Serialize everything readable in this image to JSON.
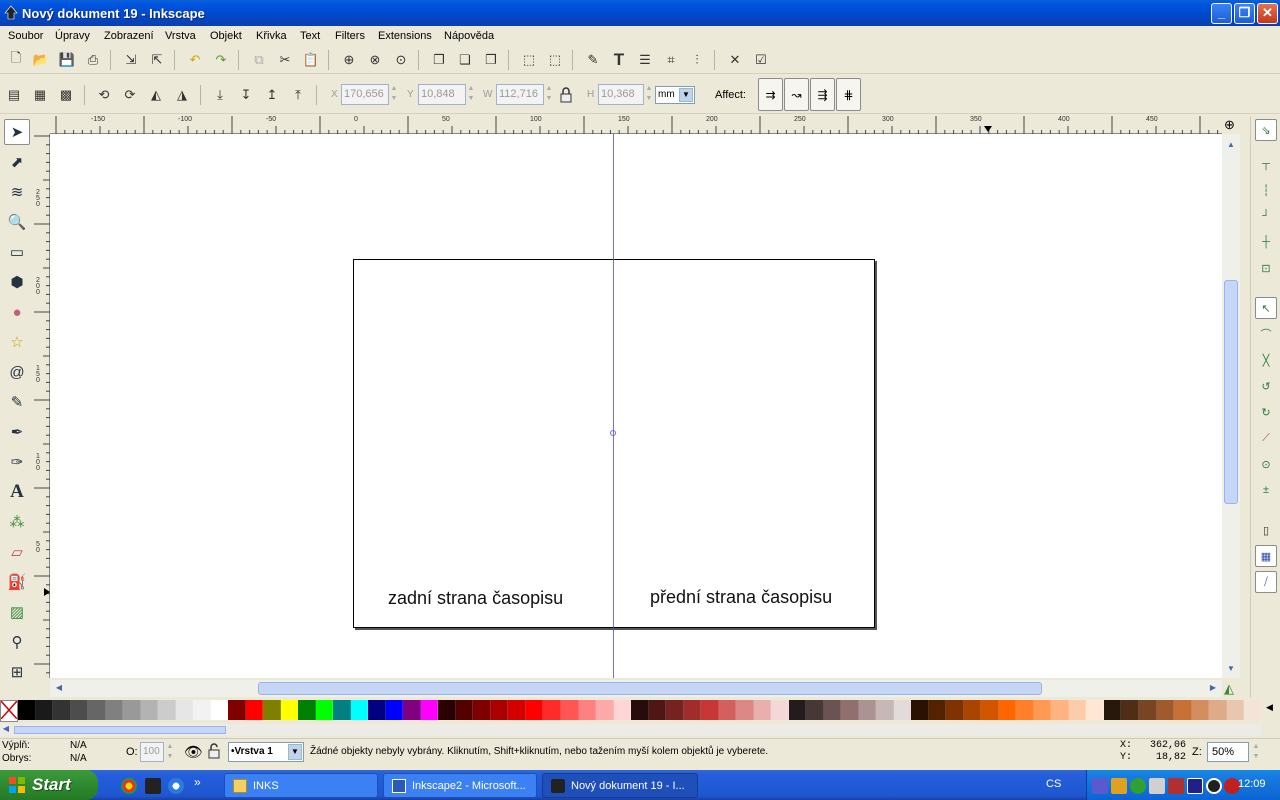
{
  "window": {
    "title": "Nový dokument 19 - Inkscape",
    "minimize": "_",
    "maximize": "❐",
    "close": "✕"
  },
  "menu": [
    "Soubor",
    "Úpravy",
    "Zobrazení",
    "Vrstva",
    "Objekt",
    "Křivka",
    "Text",
    "Filters",
    "Extensions",
    "Nápověda"
  ],
  "selectbar": {
    "x_label": "X",
    "x_value": "170,656",
    "y_label": "Y",
    "y_value": "10,848",
    "w_label": "W",
    "w_value": "112,716",
    "h_label": "H",
    "h_value": "10,368",
    "unit": "mm",
    "affect_label": "Affect:"
  },
  "ruler": {
    "h_labels": [
      "-150",
      "-100",
      "-50",
      "0",
      "50",
      "100",
      "150",
      "200",
      "250",
      "300",
      "350",
      "400",
      "450"
    ],
    "v_labels": [
      "250",
      "200",
      "150",
      "100",
      "50"
    ]
  },
  "canvas": {
    "left_text": "zadní strana časopisu",
    "right_text": "přední strana časopisu"
  },
  "status": {
    "fill_label": "Výplň:",
    "fill_value": "N/A",
    "stroke_label": "Obrys:",
    "stroke_value": "N/A",
    "opacity_label": "O:",
    "opacity_value": "100",
    "layer": "•Vrstva 1",
    "message": "Žádné objekty nebyly vybrány. Kliknutím, Shift+kliknutím, nebo tažením myší kolem objektů je vyberete.",
    "x_coord": "X:   362,06",
    "y_coord": "Y:    18,82",
    "zoom_label": "Z:",
    "zoom_value": "50%"
  },
  "taskbar": {
    "start": "Start",
    "tasks": [
      "INKS",
      "Inkscape2 - Microsoft...",
      "Nový dokument 19 - I..."
    ],
    "language": "CS",
    "clock": "12:09",
    "chevron": "»"
  },
  "palette_colors": [
    "#000000",
    "#1a1a1a",
    "#333333",
    "#4d4d4d",
    "#666666",
    "#808080",
    "#999999",
    "#b3b3b3",
    "#cccccc",
    "#e6e6e6",
    "#f2f2f2",
    "#ffffff",
    "#800000",
    "#ff0000",
    "#808000",
    "#ffff00",
    "#008000",
    "#00ff00",
    "#008080",
    "#00ffff",
    "#000080",
    "#0000ff",
    "#800080",
    "#ff00ff",
    "#2b0000",
    "#550000",
    "#800000",
    "#aa0000",
    "#d40000",
    "#ff0000",
    "#ff2a2a",
    "#ff5555",
    "#ff8080",
    "#ffaaaa",
    "#ffd5d5",
    "#280b0b",
    "#501616",
    "#782121",
    "#a02c2c",
    "#c83737",
    "#d35f5f",
    "#de8787",
    "#e9afaf",
    "#f4d7d7",
    "#241c1c",
    "#483737",
    "#6c5353",
    "#916f6f",
    "#ac9393",
    "#c8b7b7",
    "#e3dbdb",
    "#2b1100",
    "#552200",
    "#803300",
    "#aa4400",
    "#d45500",
    "#ff6600",
    "#ff7f2a",
    "#ff9955",
    "#ffb380",
    "#ffccaa",
    "#ffe6d5",
    "#28170b",
    "#502d16",
    "#784421",
    "#a05a2c",
    "#c87137",
    "#d38d5f",
    "#deaa87",
    "#e9c6af",
    "#f4e3d7"
  ]
}
